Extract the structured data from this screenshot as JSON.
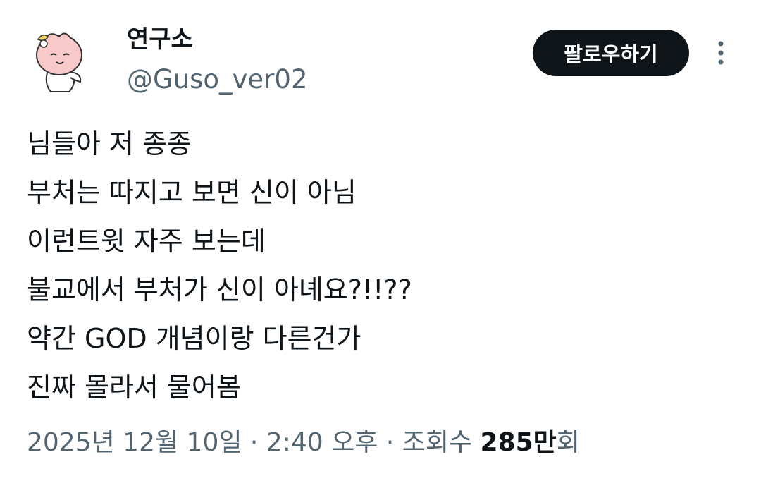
{
  "author": {
    "name": "연구소",
    "handle": "@Guso_ver02",
    "avatar_icon": "pink-peach-character-icon"
  },
  "follow_button": {
    "label": "팔로우하기"
  },
  "more_icon": "vertical-ellipsis-icon",
  "tweet": {
    "lines": [
      "님들아 저 종종",
      "부처는 따지고 보면 신이 아님",
      "이런트윗 자주 보는데",
      "불교에서 부처가 신이 아녜요?!!??",
      "약간 GOD 개념이랑 다른건가",
      "진짜 몰라서 물어봄"
    ]
  },
  "meta": {
    "date": "2025년 12월 10일",
    "sep1": " · ",
    "time": "2:40 오후",
    "sep2": " · ",
    "views_label": "조회수 ",
    "views_count": "285만",
    "views_suffix": "회"
  },
  "colors": {
    "text_primary": "#0f1419",
    "text_secondary": "#536471",
    "button_bg": "#0f1419",
    "avatar_peach": "#f8c9c9"
  }
}
